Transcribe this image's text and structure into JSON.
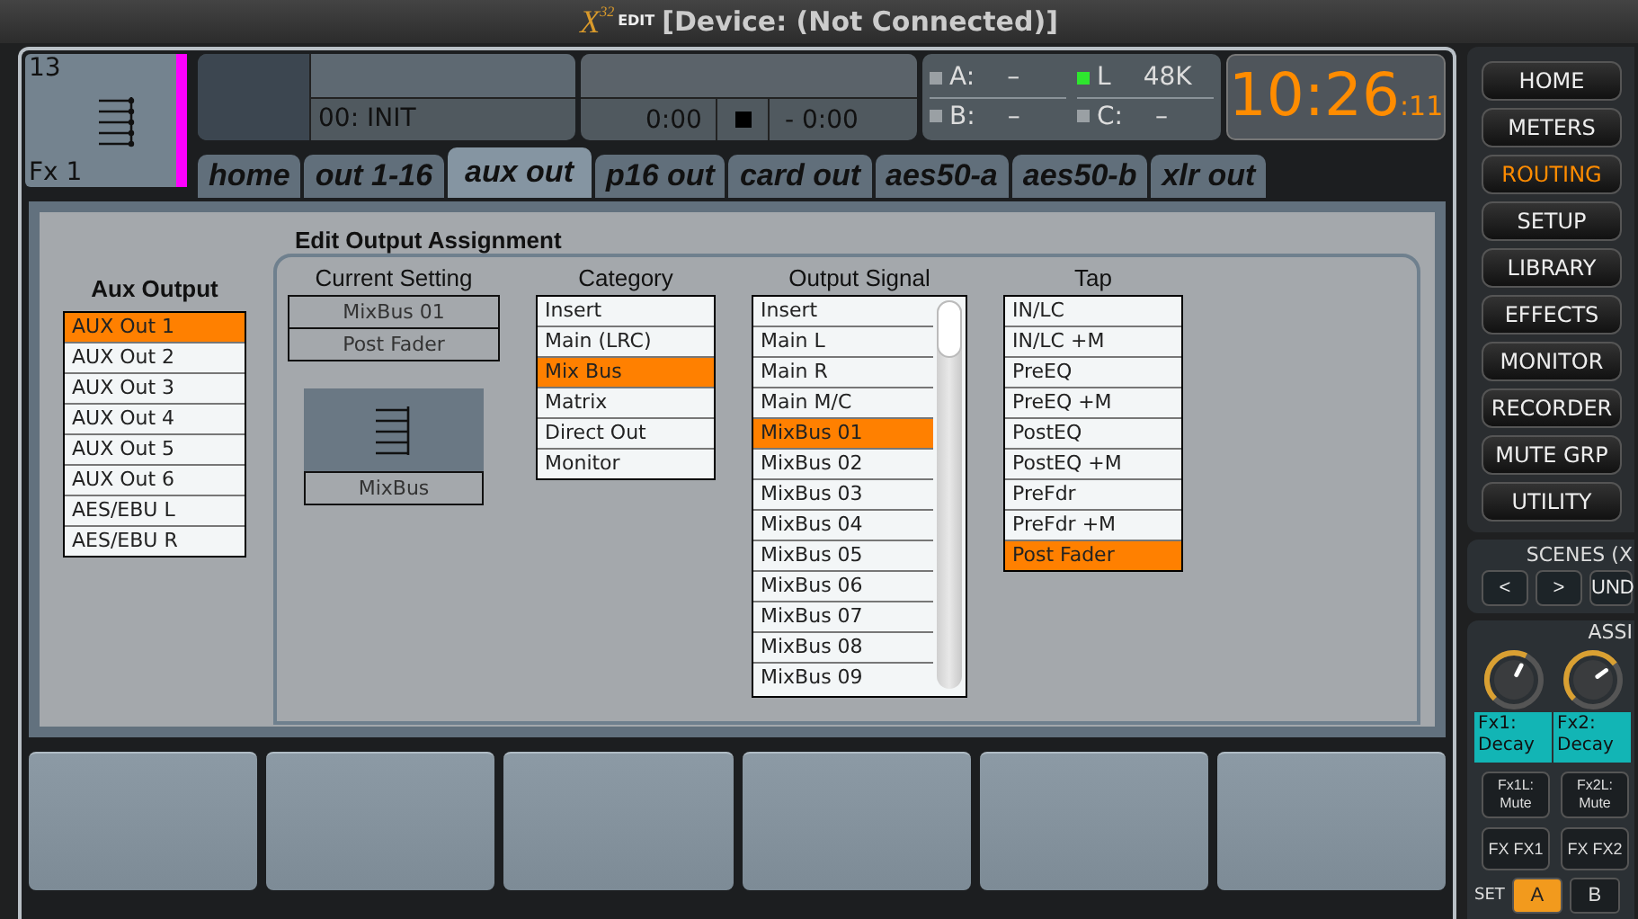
{
  "titlebar": {
    "logo": "X",
    "logo_sup": "32",
    "logo_suffix": "EDIT",
    "title": "[Device: (Not Connected)]"
  },
  "channel": {
    "number": "13",
    "name": "Fx 1",
    "color": "#ff00ff"
  },
  "scene_display": {
    "text": "00: INIT"
  },
  "transport": {
    "time": "0:00",
    "remaining": "- 0:00"
  },
  "cards": [
    {
      "label": "A:",
      "value": "–",
      "active": false
    },
    {
      "label": "L",
      "value": "48K",
      "active": true
    },
    {
      "label": "B:",
      "value": "–",
      "active": false
    },
    {
      "label": "C:",
      "value": "–",
      "active": false
    }
  ],
  "clock": {
    "time": "10:26",
    "seconds": ":11"
  },
  "tabs": [
    {
      "label": "home",
      "selected": false
    },
    {
      "label": "out 1-16",
      "selected": false
    },
    {
      "label": "aux out",
      "selected": true
    },
    {
      "label": "p16 out",
      "selected": false
    },
    {
      "label": "card out",
      "selected": false
    },
    {
      "label": "aes50-a",
      "selected": false
    },
    {
      "label": "aes50-b",
      "selected": false
    },
    {
      "label": "xlr out",
      "selected": false
    }
  ],
  "panel": {
    "heading": "Edit Output Assignment",
    "aux": {
      "title": "Aux Output",
      "items": [
        {
          "label": "AUX Out 1",
          "selected": true
        },
        {
          "label": "AUX Out 2",
          "selected": false
        },
        {
          "label": "AUX Out 3",
          "selected": false
        },
        {
          "label": "AUX Out 4",
          "selected": false
        },
        {
          "label": "AUX Out 5",
          "selected": false
        },
        {
          "label": "AUX Out 6",
          "selected": false
        },
        {
          "label": "AES/EBU L",
          "selected": false
        },
        {
          "label": "AES/EBU R",
          "selected": false
        }
      ]
    },
    "current": {
      "title": "Current Setting",
      "signal": "MixBus 01",
      "tap": "Post Fader",
      "type": "MixBus"
    },
    "category": {
      "title": "Category",
      "items": [
        {
          "label": "Insert",
          "selected": false
        },
        {
          "label": "Main (LRC)",
          "selected": false
        },
        {
          "label": "Mix Bus",
          "selected": true
        },
        {
          "label": "Matrix",
          "selected": false
        },
        {
          "label": "Direct Out",
          "selected": false
        },
        {
          "label": "Monitor",
          "selected": false
        }
      ]
    },
    "output_signal": {
      "title": "Output Signal",
      "items": [
        {
          "label": "Insert",
          "selected": false
        },
        {
          "label": "Main L",
          "selected": false
        },
        {
          "label": "Main R",
          "selected": false
        },
        {
          "label": "Main M/C",
          "selected": false
        },
        {
          "label": "MixBus 01",
          "selected": true
        },
        {
          "label": "MixBus 02",
          "selected": false
        },
        {
          "label": "MixBus 03",
          "selected": false
        },
        {
          "label": "MixBus 04",
          "selected": false
        },
        {
          "label": "MixBus 05",
          "selected": false
        },
        {
          "label": "MixBus 06",
          "selected": false
        },
        {
          "label": "MixBus 07",
          "selected": false
        },
        {
          "label": "MixBus 08",
          "selected": false
        },
        {
          "label": "MixBus 09",
          "selected": false
        }
      ]
    },
    "tap": {
      "title": "Tap",
      "items": [
        {
          "label": "IN/LC",
          "selected": false
        },
        {
          "label": "IN/LC +M",
          "selected": false
        },
        {
          "label": "PreEQ",
          "selected": false
        },
        {
          "label": "PreEQ +M",
          "selected": false
        },
        {
          "label": "PostEQ",
          "selected": false
        },
        {
          "label": "PostEQ +M",
          "selected": false
        },
        {
          "label": "PreFdr",
          "selected": false
        },
        {
          "label": "PreFdr +M",
          "selected": false
        },
        {
          "label": "Post Fader",
          "selected": true
        }
      ]
    }
  },
  "nav": [
    {
      "label": "HOME",
      "selected": false
    },
    {
      "label": "METERS",
      "selected": false
    },
    {
      "label": "ROUTING",
      "selected": true
    },
    {
      "label": "SETUP",
      "selected": false
    },
    {
      "label": "LIBRARY",
      "selected": false
    },
    {
      "label": "EFFECTS",
      "selected": false
    },
    {
      "label": "MONITOR",
      "selected": false
    },
    {
      "label": "RECORDER",
      "selected": false
    },
    {
      "label": "MUTE GRP",
      "selected": false
    },
    {
      "label": "UTILITY",
      "selected": false
    }
  ],
  "scenes": {
    "title": "SCENES (X",
    "buttons": [
      "<",
      ">",
      "UND"
    ]
  },
  "assign": {
    "title": "ASSI",
    "knobs": [
      {
        "label": "Fx1: Decay",
        "level": 0.6
      },
      {
        "label": "Fx2: Decay",
        "level": 0.7
      }
    ],
    "mutes": [
      "Fx1L: Mute",
      "Fx2L: Mute"
    ],
    "fx_buttons": [
      "FX FX1",
      "FX FX2"
    ],
    "set": {
      "label": "SET",
      "buttons": [
        {
          "label": "A",
          "selected": true
        },
        {
          "label": "B",
          "selected": false
        }
      ]
    }
  }
}
